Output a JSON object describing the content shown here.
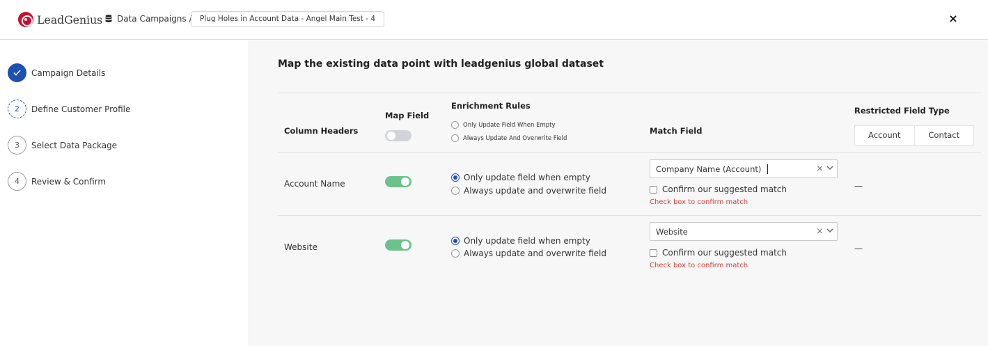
{
  "header": {
    "brand": "LeadGenius",
    "breadcrumb_root": "Data Campaigns",
    "breadcrumb_sep": "/",
    "campaign_name": "Plug Holes in Account Data - Angel Main Test - 4",
    "close_label": "×"
  },
  "sidebar": {
    "steps": [
      {
        "number": "",
        "label": "Campaign Details",
        "state": "done"
      },
      {
        "number": "2",
        "label": "Define Customer Profile",
        "state": "active"
      },
      {
        "number": "3",
        "label": "Select Data Package",
        "state": "pending"
      },
      {
        "number": "4",
        "label": "Review & Confirm",
        "state": "pending"
      }
    ]
  },
  "main": {
    "title": "Map the existing data point with leadgenius global dataset",
    "table": {
      "headers": {
        "column_headers": "Column Headers",
        "map_field": "Map Field",
        "enrichment_rules": "Enrichment Rules",
        "match_field": "Match Field",
        "restricted_field_type": "Restricted Field Type"
      },
      "header_map_toggle": false,
      "header_rule_options": [
        "Only Update Field When Empty",
        "Always Update And Overwrite Field"
      ],
      "restricted_options": [
        "Account",
        "Contact"
      ],
      "rows": [
        {
          "column_header": "Account Name",
          "map_enabled": true,
          "rule_options": [
            "Only update field when empty",
            "Always update and overwrite field"
          ],
          "selected_rule": 0,
          "match_value": "Company Name (Account)",
          "confirm_label": "Confirm our suggested match",
          "confirm_checked": false,
          "warning": "Check box to confirm match",
          "restricted": "—"
        },
        {
          "column_header": "Website",
          "map_enabled": true,
          "rule_options": [
            "Only update field when empty",
            "Always update and overwrite field"
          ],
          "selected_rule": 0,
          "match_value": "Website",
          "confirm_label": "Confirm our suggested match",
          "confirm_checked": false,
          "warning": "Check box to confirm match",
          "restricted": "—"
        }
      ]
    }
  },
  "colors": {
    "accent": "#1e4fb5",
    "toggle_on": "#6cc28a",
    "warning": "#d0413f",
    "brand": "#c8102e"
  }
}
